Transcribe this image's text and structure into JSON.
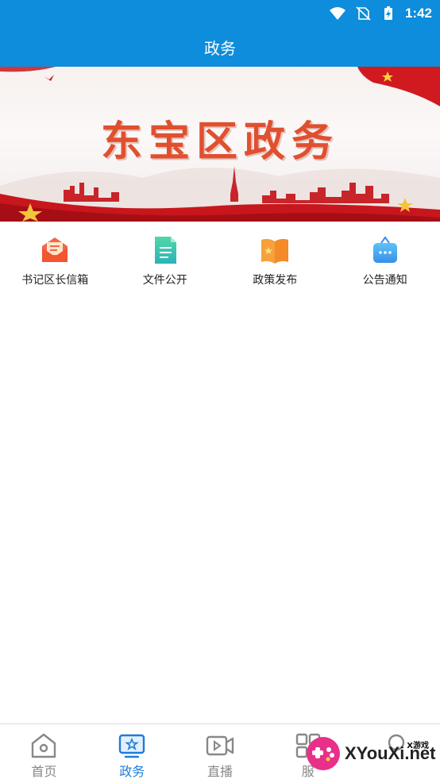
{
  "status_bar": {
    "time": "1:42",
    "icons": [
      "wifi-icon",
      "no-sim-icon",
      "battery-charging-icon"
    ]
  },
  "app_bar": {
    "title": "政务"
  },
  "banner": {
    "title": "东宝区政务"
  },
  "quick_menu": [
    {
      "label": "书记区长信箱",
      "icon": "mail-envelope-icon",
      "color": "#f0674a"
    },
    {
      "label": "文件公开",
      "icon": "document-icon",
      "color": "#3cc6a8"
    },
    {
      "label": "政策发布",
      "icon": "open-book-icon",
      "color": "#f6a13a"
    },
    {
      "label": "公告通知",
      "icon": "notice-board-icon",
      "color": "#4aa8f2"
    }
  ],
  "tab_bar": {
    "tabs": [
      {
        "label": "首页",
        "icon": "home-icon",
        "active": false
      },
      {
        "label": "政务",
        "icon": "government-tv-icon",
        "active": true
      },
      {
        "label": "直播",
        "icon": "video-camera-icon",
        "active": false
      },
      {
        "label": "服",
        "icon": "grid-apps-icon",
        "active": false
      }
    ],
    "active_color": "#1e7cd8",
    "inactive_color": "#888888"
  },
  "watermark": {
    "brand": "XYouXi.net",
    "small": "X游戏"
  },
  "colors": {
    "primary": "#0d8ddb"
  }
}
